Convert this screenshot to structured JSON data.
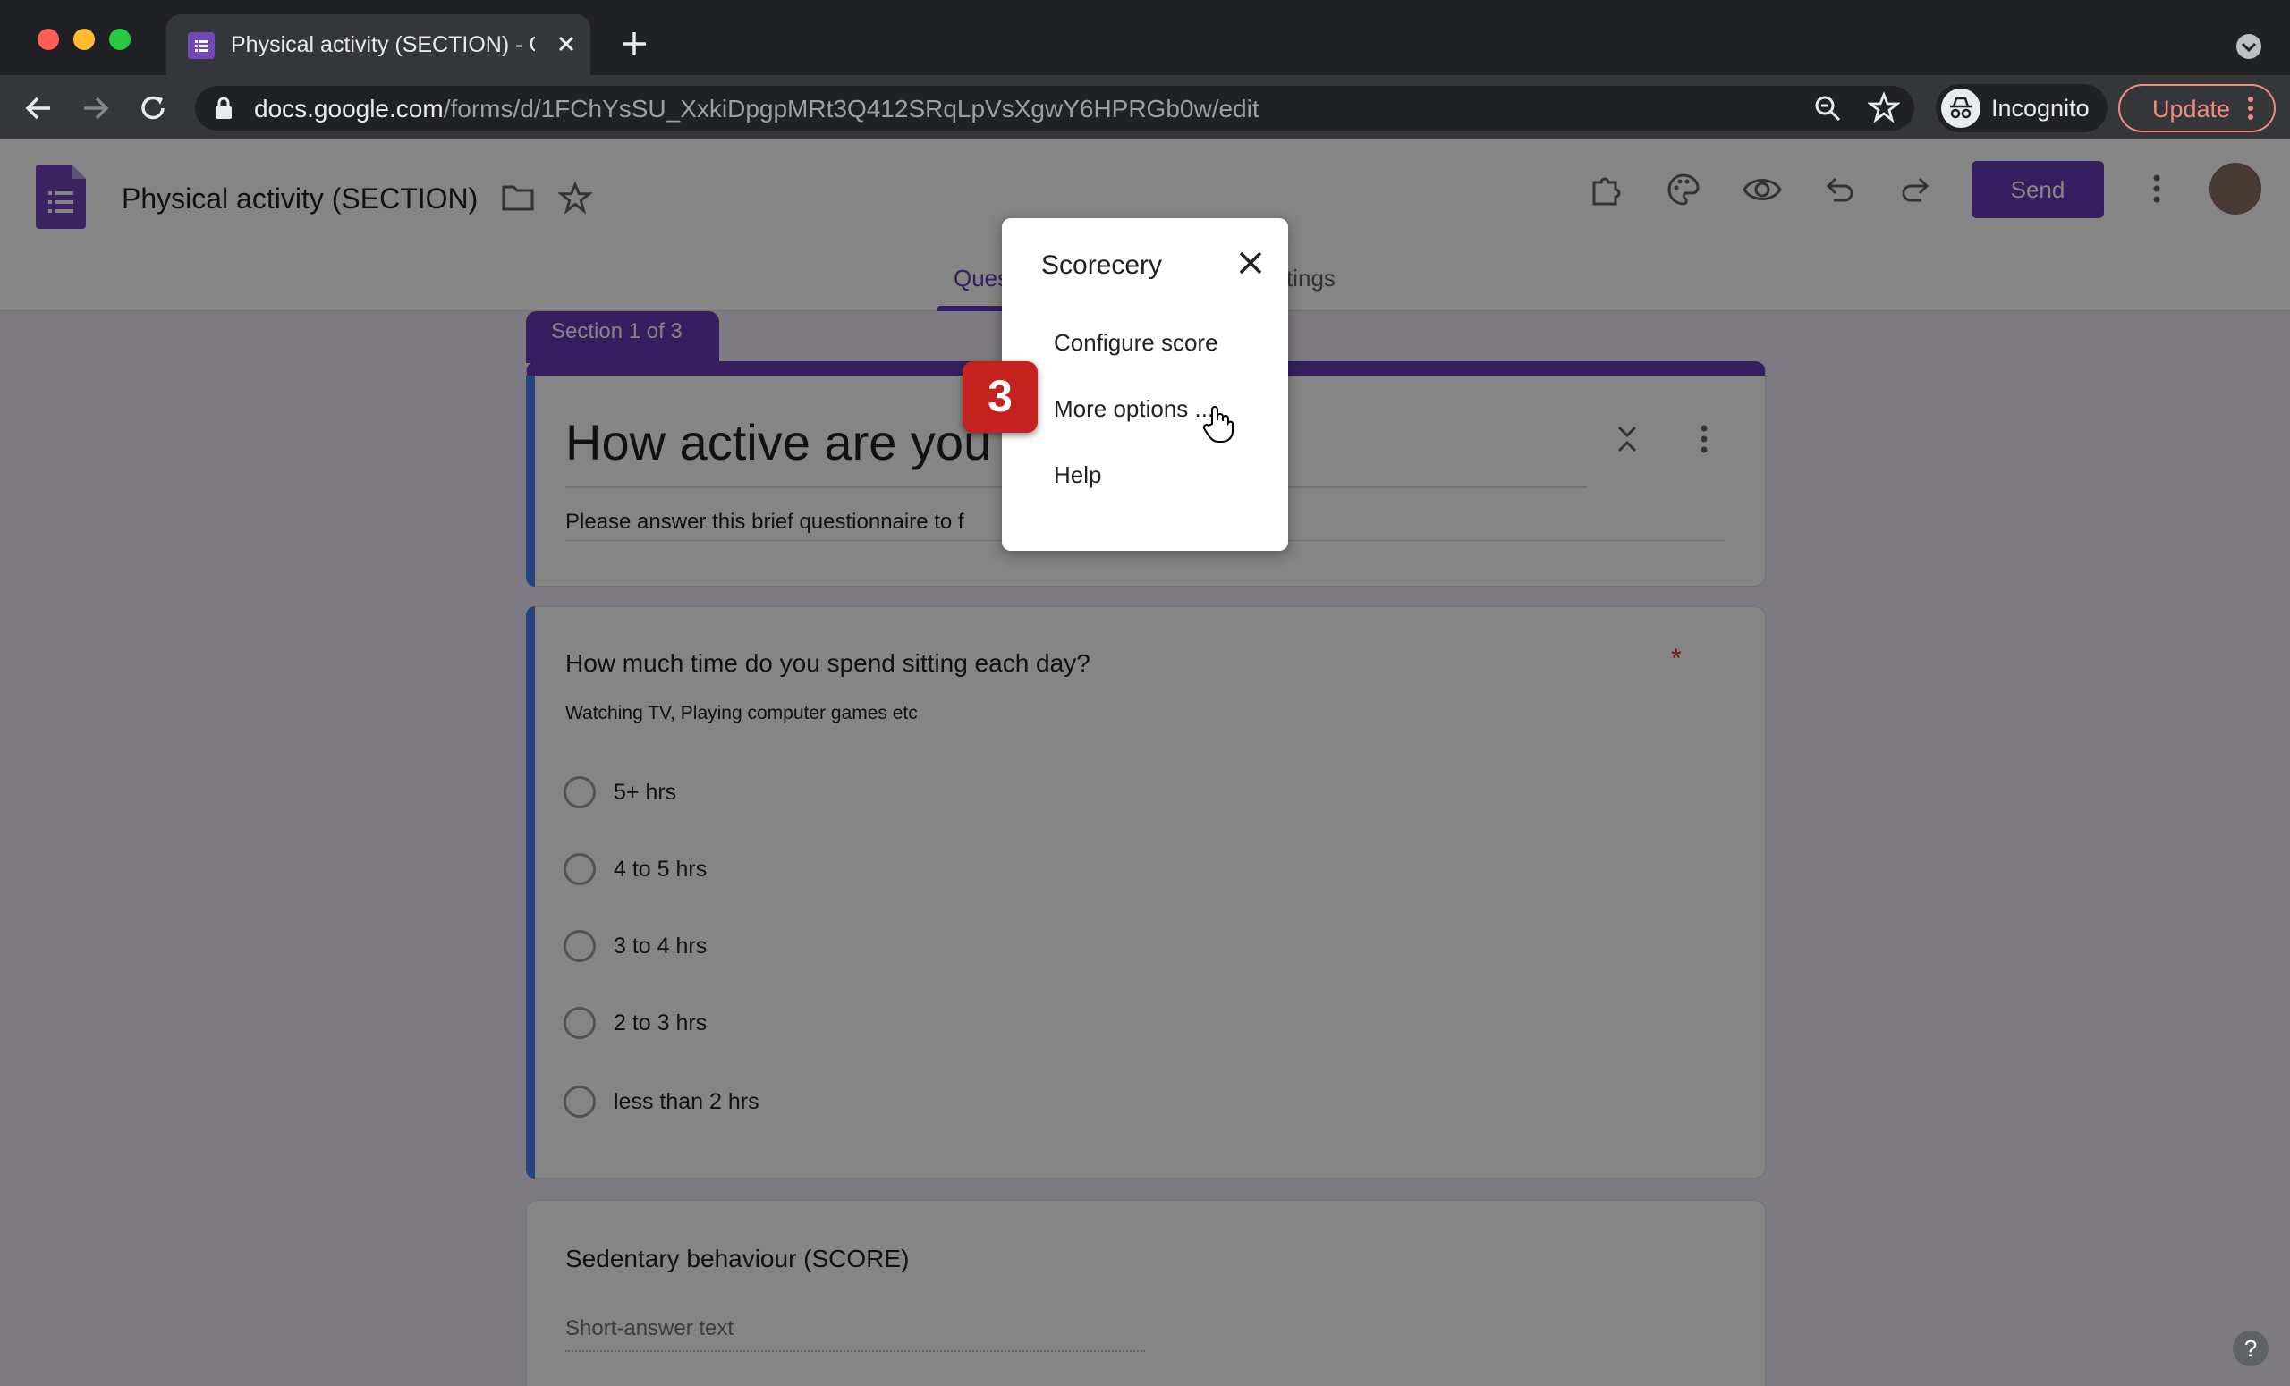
{
  "browser": {
    "tab_title": "Physical activity (SECTION) - G",
    "url_host": "docs.google.com",
    "url_path": "/forms/d/1FChYsSU_XxkiDpgpMRt3Q412SRqLpVsXgwY6HPRGb0w/edit",
    "incognito_label": "Incognito",
    "update_label": "Update"
  },
  "form_header": {
    "title": "Physical activity (SECTION)",
    "send_label": "Send",
    "tab_questions_visible": "Ques",
    "tab_settings_visible": "tings"
  },
  "section": {
    "label": "Section 1 of 3",
    "title_visible": "How active are you",
    "description_visible": "Please answer this brief questionnaire to f"
  },
  "question1": {
    "title": "How much time do you spend sitting each day?",
    "description": "Watching TV, Playing computer games etc",
    "required_mark": "*",
    "options": [
      "5+ hrs",
      "4 to 5 hrs",
      "3 to 4 hrs",
      "2 to 3 hrs",
      "less than 2 hrs"
    ]
  },
  "question2": {
    "title": "Sedentary behaviour (SCORE)",
    "placeholder": "Short-answer text"
  },
  "popup": {
    "title": "Scorecery",
    "items": [
      "Configure score",
      "More options ...",
      "Help"
    ]
  },
  "step_badge": "3",
  "help_label": "?",
  "colors": {
    "brand": "#673ab7",
    "accent_bar": "#4285f4",
    "required": "#d93025",
    "badge": "#c5221f"
  }
}
